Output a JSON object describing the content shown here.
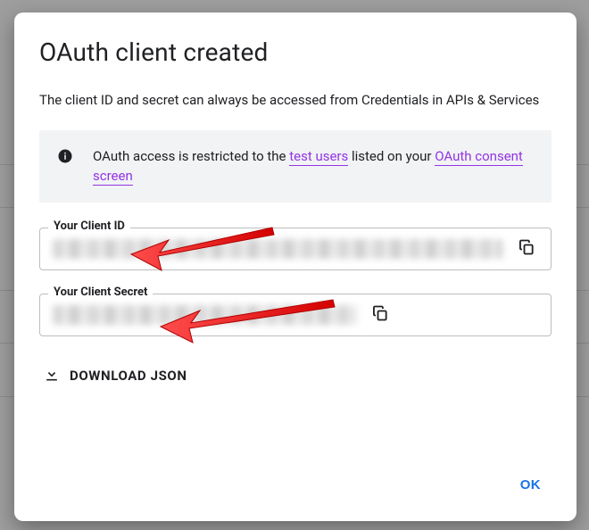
{
  "dialog": {
    "title": "OAuth client created",
    "subtext": "The client ID and secret can always be accessed from Credentials in APIs & Services",
    "info_prefix": "OAuth access is restricted to the ",
    "info_link1": "test users",
    "info_mid": " listed on your ",
    "info_link2": "OAuth consent screen"
  },
  "fields": {
    "client_id": {
      "label": "Your Client ID"
    },
    "client_secret": {
      "label": "Your Client Secret"
    }
  },
  "actions": {
    "download": "DOWNLOAD JSON",
    "ok": "OK"
  },
  "icons": {
    "info": "info-icon",
    "copy": "copy-icon",
    "download": "download-icon"
  }
}
